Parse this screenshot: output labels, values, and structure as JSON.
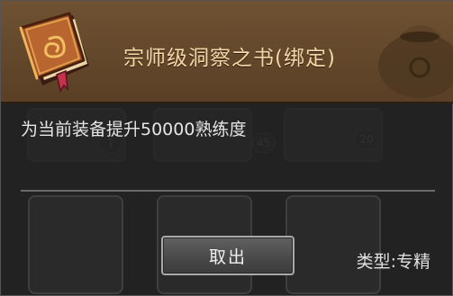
{
  "item": {
    "name": "宗师级洞察之书(绑定)",
    "description": "为当前装备提升50000熟练度",
    "type_text": "类型:专精",
    "icon": "book-icon"
  },
  "actions": {
    "take_out_label": "取出"
  },
  "background": {
    "badges": [
      "1",
      "45",
      "20"
    ]
  },
  "colors": {
    "header": "#6f5233",
    "title": "#f4d7a6",
    "panel": "#222222"
  }
}
